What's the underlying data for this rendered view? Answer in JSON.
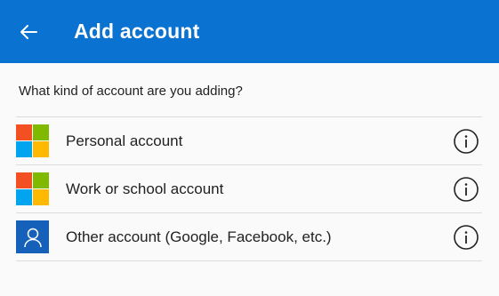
{
  "header": {
    "back_icon": "arrow-left-icon",
    "title": "Add account",
    "color": "#0a72d0"
  },
  "prompt": "What kind of account are you adding?",
  "accounts": [
    {
      "label": "Personal account",
      "icon": "microsoft-logo-icon",
      "info_icon": "info-circle-icon"
    },
    {
      "label": "Work or school account",
      "icon": "microsoft-logo-icon",
      "info_icon": "info-circle-icon"
    },
    {
      "label": "Other account (Google, Facebook, etc.)",
      "icon": "person-icon",
      "info_icon": "info-circle-icon"
    }
  ]
}
